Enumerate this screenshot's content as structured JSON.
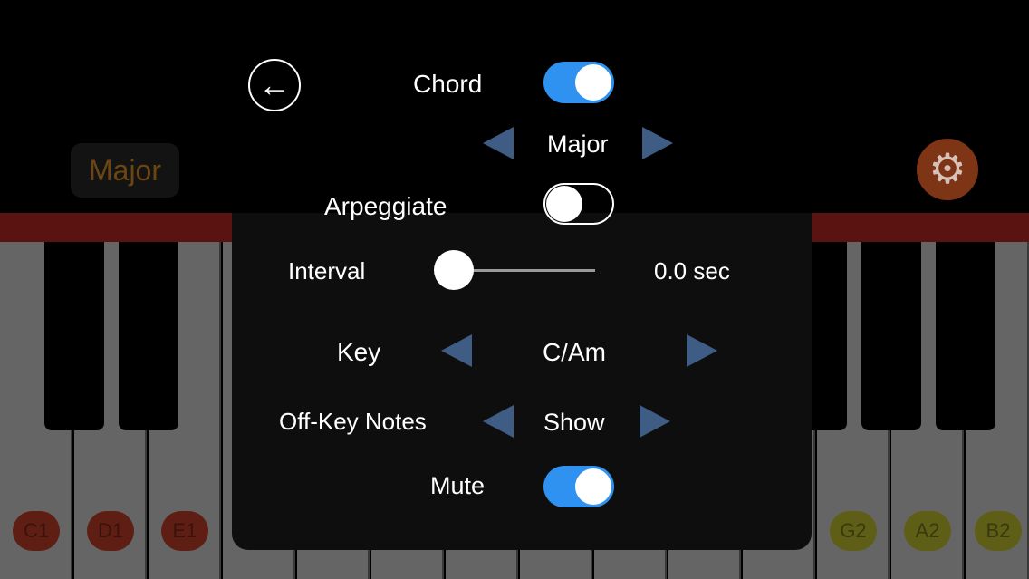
{
  "background": {
    "chord_chip": "Major",
    "gear_icon": "gear-icon",
    "notes_left": [
      "C1",
      "D1",
      "E1"
    ],
    "notes_right": [
      "G2",
      "A2",
      "B2"
    ],
    "colors": {
      "red_notes": "#5e1e14",
      "yellow_notes": "#5e5e16",
      "gear": "#7e3516"
    }
  },
  "settings": {
    "back_icon": "arrow-left-icon",
    "chord": {
      "label": "Chord",
      "on": true
    },
    "chord_type": {
      "value": "Major"
    },
    "arpeggiate": {
      "label": "Arpeggiate",
      "on": false
    },
    "interval": {
      "label": "Interval",
      "value": "0.0 sec",
      "level": 0
    },
    "key": {
      "label": "Key",
      "value": "C/Am"
    },
    "off_key_notes": {
      "label": "Off-Key Notes",
      "value": "Show"
    },
    "mute": {
      "label": "Mute",
      "on": true
    },
    "accent_color": "#2f91f0"
  }
}
